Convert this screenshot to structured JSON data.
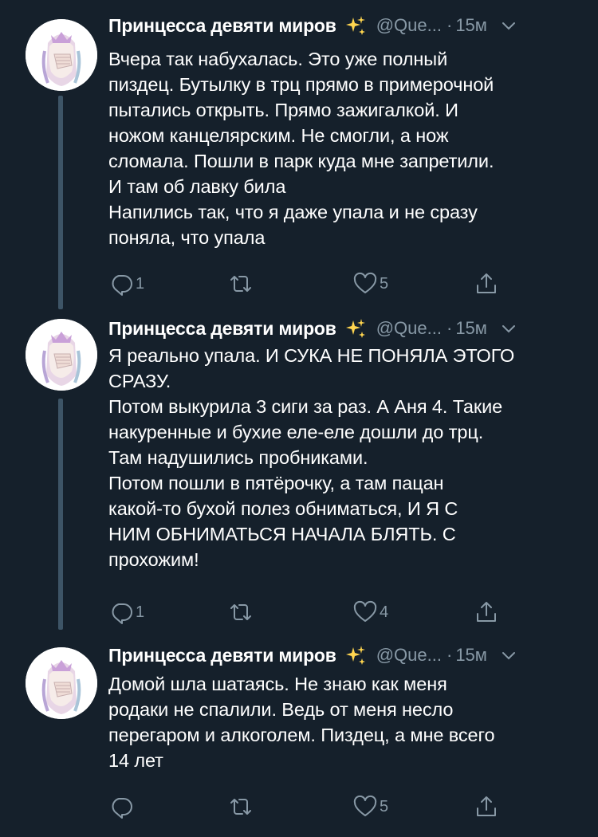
{
  "tweets": [
    {
      "author_name": "Принцесса девяти миров",
      "handle": "@Que...",
      "separator": "·",
      "time": "15м",
      "text": "Вчера так набухалась. Это уже полный\nпиздец. Бутылку в трц прямо в примерочной\nпытались открыть. Прямо зажигалкой. И\nножом канцелярским. Не смогли, а нож\nсломала. Пошли в парк куда мне запретили.\nИ там об лавку била\nНапились так, что я даже упала и не сразу\nпоняла, что упала",
      "replies": "1",
      "retweets": "",
      "likes": "5"
    },
    {
      "author_name": "Принцесса девяти миров",
      "handle": "@Que...",
      "separator": "·",
      "time": "15м",
      "text": "Я реально упала. И СУКА НЕ ПОНЯЛА ЭТОГО\nСРАЗУ.\nПотом выкурила 3 сиги за раз. А Аня 4. Такие\nнакуренные и бухие еле-еле дошли до трц.\nТам надушились пробниками.\nПотом пошли в пятёрочку, а там пацан\nкакой-то бухой полез обниматься, И Я С\nНИМ ОБНИМАТЬСЯ НАЧАЛА БЛЯТЬ. С\nпрохожим!",
      "replies": "1",
      "retweets": "",
      "likes": "4"
    },
    {
      "author_name": "Принцесса девяти миров",
      "handle": "@Que...",
      "separator": "·",
      "time": "15м",
      "text": "Домой шла шатаясь. Не знаю как меня\nродаки не спалили. Ведь от меня несло\nперегаром и алкоголем. Пиздец, а мне всего\n14 лет",
      "replies": "",
      "retweets": "",
      "likes": "5"
    }
  ],
  "icons": {
    "sparkle": "sparkles-icon",
    "menu": "chevron-down-icon",
    "reply": "reply-icon",
    "retweet": "retweet-icon",
    "like": "heart-icon",
    "share": "share-icon"
  },
  "colors": {
    "background": "#15202b",
    "text": "#ffffff",
    "secondary": "#8899a6",
    "thread_line": "#3d5466",
    "sparkle": "#ffd54f"
  }
}
